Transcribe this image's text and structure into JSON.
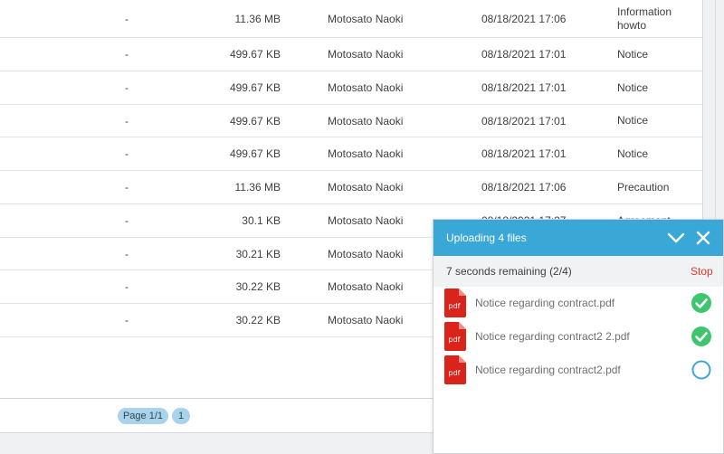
{
  "table": {
    "rows": [
      {
        "dash": "-",
        "size": "11.36 MB",
        "owner": "Motosato Naoki",
        "date": "08/18/2021 17:06",
        "category": "Information howto"
      },
      {
        "dash": "-",
        "size": "499.67 KB",
        "owner": "Motosato Naoki",
        "date": "08/18/2021 17:01",
        "category": "Notice"
      },
      {
        "dash": "-",
        "size": "499.67 KB",
        "owner": "Motosato Naoki",
        "date": "08/18/2021 17:01",
        "category": "Notice"
      },
      {
        "dash": "-",
        "size": "499.67 KB",
        "owner": "Motosato Naoki",
        "date": "08/18/2021 17:01",
        "category": "Notice"
      },
      {
        "dash": "-",
        "size": "499.67 KB",
        "owner": "Motosato Naoki",
        "date": "08/18/2021 17:01",
        "category": "Notice"
      },
      {
        "dash": "-",
        "size": "11.36 MB",
        "owner": "Motosato Naoki",
        "date": "08/18/2021 17:06",
        "category": "Precaution"
      },
      {
        "dash": "-",
        "size": "30.1 KB",
        "owner": "Motosato Naoki",
        "date": "08/18/2021 17:27",
        "category": "Agreement"
      },
      {
        "dash": "-",
        "size": "30.21 KB",
        "owner": "Motosato Naoki",
        "date": "",
        "category": ""
      },
      {
        "dash": "-",
        "size": "30.22 KB",
        "owner": "Motosato Naoki",
        "date": "",
        "category": ""
      },
      {
        "dash": "-",
        "size": "30.22 KB",
        "owner": "Motosato Naoki",
        "date": "",
        "category": ""
      }
    ]
  },
  "pagination": {
    "label": "Page 1/1",
    "current": "1"
  },
  "upload": {
    "title": "Uploading 4 files",
    "status": "7 seconds remaining (2/4)",
    "stop_label": "Stop",
    "files": [
      {
        "name": "Notice regarding contract.pdf",
        "type_label": "pdf",
        "state": "done",
        "state_icon": "check-circle-icon"
      },
      {
        "name": "Notice regarding contract2 2.pdf",
        "type_label": "pdf",
        "state": "done",
        "state_icon": "check-circle-icon"
      },
      {
        "name": "Notice regarding contract2.pdf",
        "type_label": "pdf",
        "state": "pending",
        "state_icon": "empty-circle-icon"
      }
    ],
    "colors": {
      "header": "#3aa8d6",
      "success": "#3ec56e",
      "pending": "#3aa8d6",
      "stop": "#e0382c",
      "pdf": "#d9231b"
    }
  }
}
